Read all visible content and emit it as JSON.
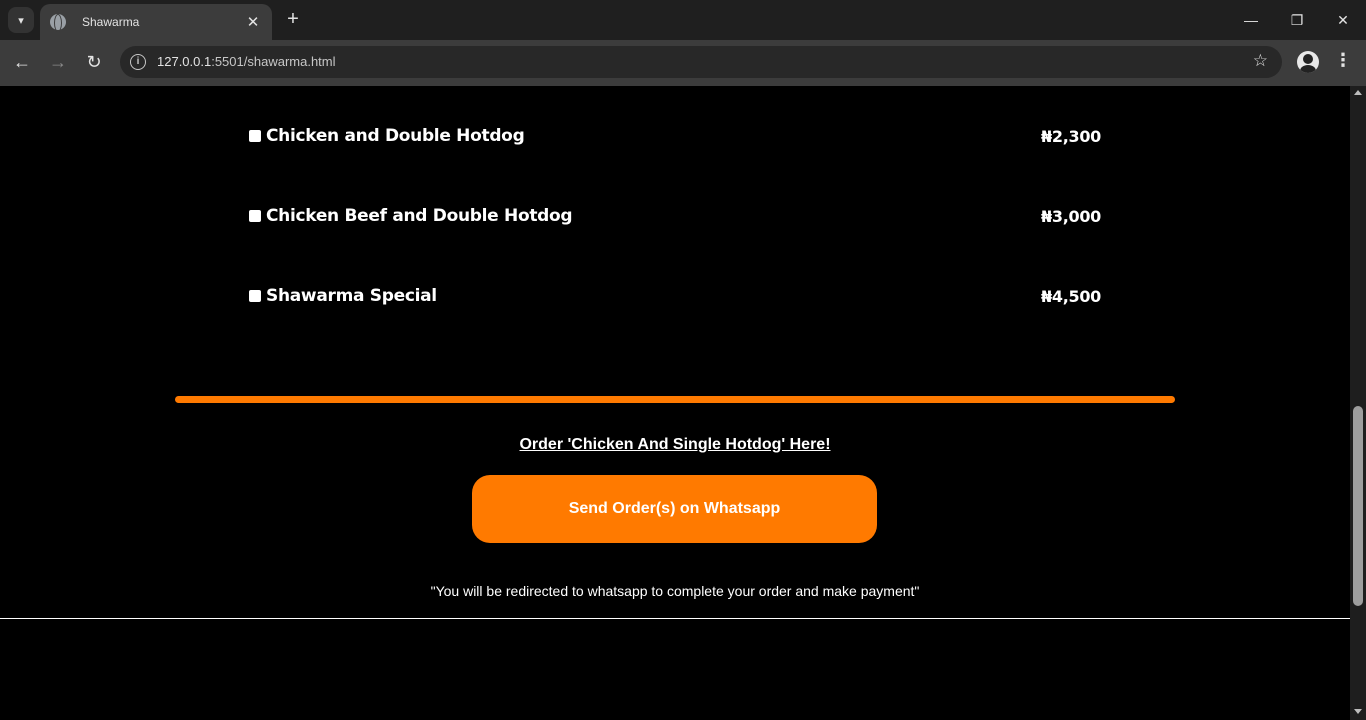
{
  "browser": {
    "tab_title": "Shawarma",
    "url_host": "127.0.0.1",
    "url_path": ":5501/shawarma.html"
  },
  "menu": {
    "items": [
      {
        "name": "Chicken and Double Hotdog",
        "price": "₦2,300",
        "checked": false
      },
      {
        "name": "Chicken Beef and Double Hotdog",
        "price": "₦3,000",
        "checked": false
      },
      {
        "name": "Shawarma Special",
        "price": "₦4,500",
        "checked": false
      }
    ]
  },
  "order": {
    "link_text": "Order 'Chicken And Single Hotdog' Here!",
    "button_label": "Send Order(s) on Whatsapp",
    "note": "\"You will be redirected to whatsapp to complete your order and make payment\""
  },
  "colors": {
    "accent": "#ff7a00",
    "background": "#000000",
    "text": "#ffffff"
  }
}
